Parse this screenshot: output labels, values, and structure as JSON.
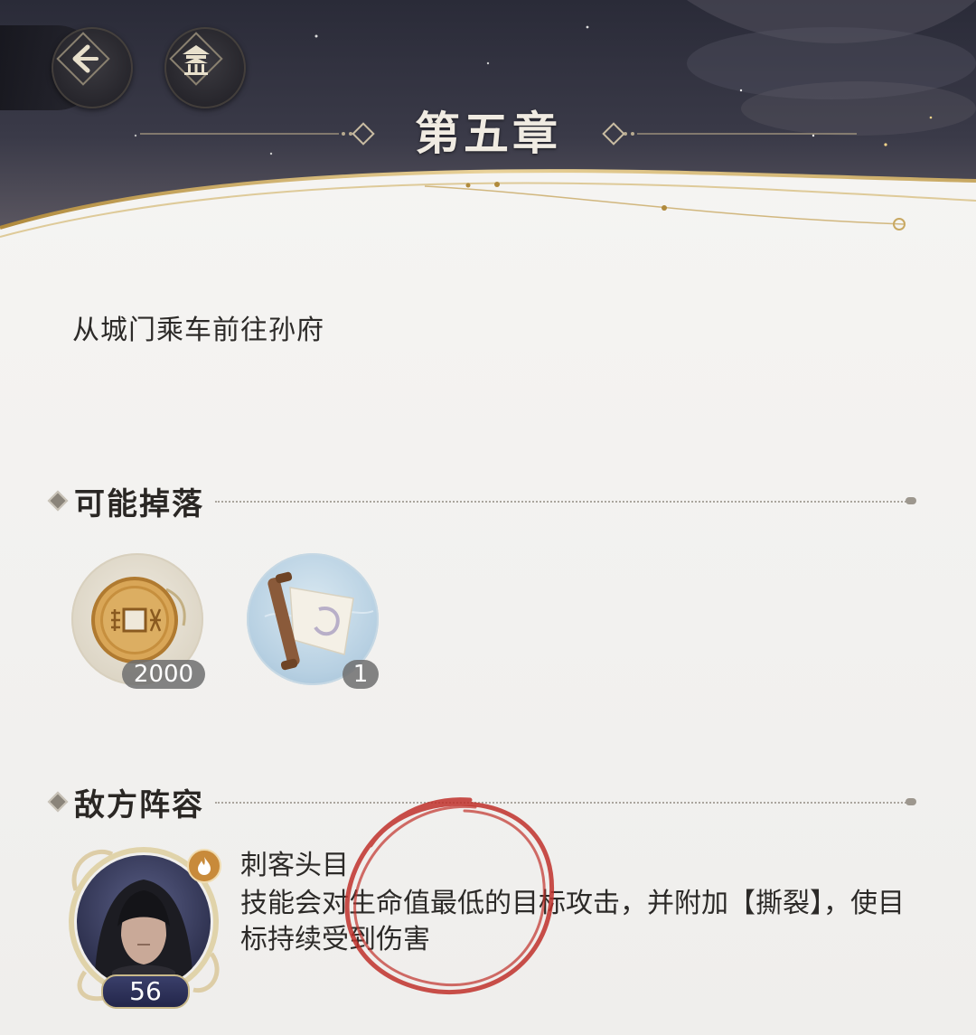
{
  "header": {
    "chapter_title": "第五章"
  },
  "stage": {
    "subtitle": "从城门乘车前往孙府"
  },
  "drops": {
    "section_label": "可能掉落",
    "items": [
      {
        "name": "coin-icon",
        "count": "2000"
      },
      {
        "name": "scroll-icon",
        "count": "1"
      }
    ]
  },
  "enemies": {
    "section_label": "敌方阵容",
    "list": [
      {
        "name": "刺客头目",
        "level": "56",
        "element": "fire-icon",
        "description": "技能会对生命值最低的目标攻击，并附加【撕裂】，使目标持续受到伤害"
      }
    ]
  },
  "colors": {
    "header_dark": "#1f2230",
    "gold": "#c8a862",
    "annotation_red": "#c0302a"
  }
}
